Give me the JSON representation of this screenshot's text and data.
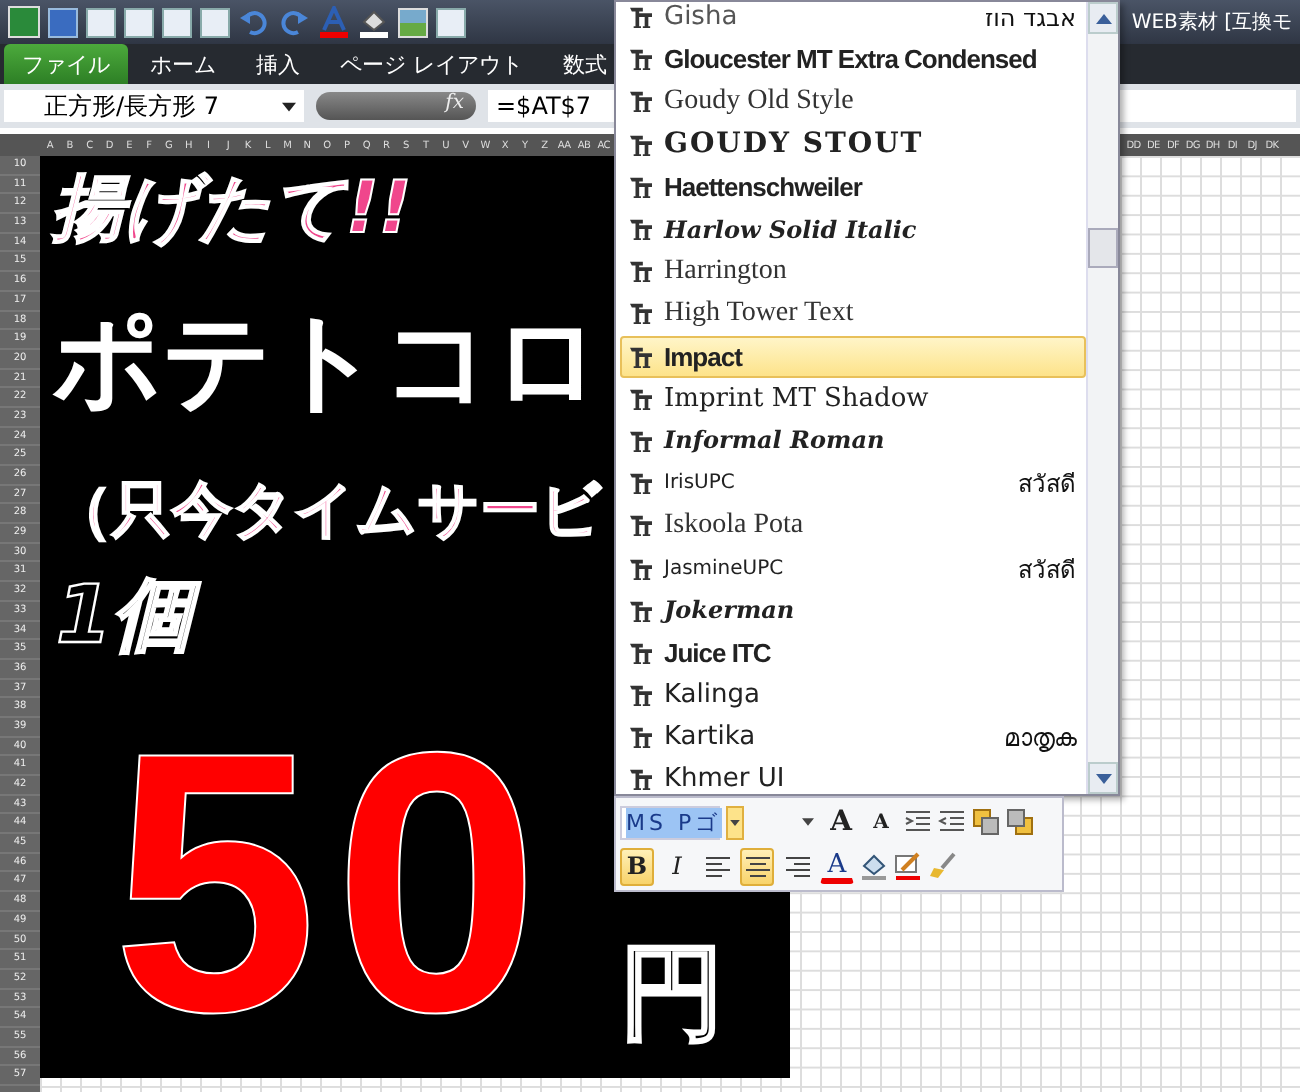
{
  "window": {
    "title": "WEB素材 [互換モ"
  },
  "tabs": [
    {
      "label": "ファイル",
      "selected": true
    },
    {
      "label": "ホーム",
      "selected": false
    },
    {
      "label": "挿入",
      "selected": false
    },
    {
      "label": "ページ レイアウト",
      "selected": false
    },
    {
      "label": "数式",
      "selected": false
    }
  ],
  "formula_bar": {
    "name_box": "正方形/長方形 7",
    "fx": "fx",
    "formula": "=$AT$7"
  },
  "columns_left": [
    "A",
    "B",
    "C",
    "D",
    "E",
    "F",
    "G",
    "H",
    "I",
    "J",
    "K",
    "L",
    "M",
    "N",
    "O",
    "P",
    "Q",
    "R",
    "S",
    "T",
    "U",
    "V",
    "W",
    "X",
    "Y",
    "Z",
    "AA",
    "AB",
    "AC"
  ],
  "columns_right": [
    "DD",
    "DE",
    "DF",
    "DG",
    "DH",
    "DI",
    "DJ",
    "DK"
  ],
  "rows": [
    "10",
    "11",
    "12",
    "13",
    "14",
    "15",
    "16",
    "17",
    "18",
    "19",
    "20",
    "21",
    "22",
    "23",
    "24",
    "25",
    "26",
    "27",
    "28",
    "29",
    "30",
    "31",
    "32",
    "33",
    "34",
    "35",
    "36",
    "37",
    "38",
    "39",
    "40",
    "41",
    "42",
    "43",
    "44",
    "45",
    "46",
    "47",
    "48",
    "49",
    "50",
    "51",
    "52",
    "53",
    "54",
    "55",
    "56",
    "57"
  ],
  "sheet": {
    "headline": "揚げたて!!",
    "product": "ポテトコロ",
    "note": "（只今タイムサービ",
    "unit": "1個",
    "price": "50",
    "currency": "円"
  },
  "font_menu": {
    "items": [
      {
        "name": "Gisha",
        "sample": "אבגד הוז",
        "kind": "light",
        "selected": false
      },
      {
        "name": "Gloucester MT Extra Condensed",
        "kind": "condensed",
        "selected": false
      },
      {
        "name": "Goudy Old Style",
        "kind": "serif",
        "selected": false
      },
      {
        "name": "GOUDY STOUT",
        "kind": "heavy",
        "selected": false
      },
      {
        "name": "Haettenschweiler",
        "kind": "condensed",
        "selected": false
      },
      {
        "name": "Harlow Solid Italic",
        "kind": "script",
        "selected": false
      },
      {
        "name": "Harrington",
        "kind": "serif",
        "selected": false
      },
      {
        "name": "High Tower Text",
        "kind": "serif",
        "selected": false
      },
      {
        "name": "Impact",
        "kind": "condensed",
        "selected": true
      },
      {
        "name": "Imprint MT Shadow",
        "kind": "boldserif",
        "selected": false
      },
      {
        "name": "Informal Roman",
        "kind": "script",
        "selected": false
      },
      {
        "name": "IrisUPC",
        "sample": "สวัสดี",
        "kind": "small",
        "selected": false
      },
      {
        "name": "Iskoola Pota",
        "kind": "serif",
        "selected": false
      },
      {
        "name": "JasmineUPC",
        "sample": "สวัสดี",
        "kind": "small",
        "selected": false
      },
      {
        "name": "Jokerman",
        "kind": "script",
        "selected": false
      },
      {
        "name": "Juice ITC",
        "kind": "condensed",
        "selected": false
      },
      {
        "name": "Kalinga",
        "kind": "sans",
        "selected": false
      },
      {
        "name": "Kartika",
        "sample": "മാതൃക",
        "kind": "sans",
        "selected": false
      },
      {
        "name": "Khmer UI",
        "kind": "sans",
        "selected": false
      }
    ]
  },
  "mini_toolbar": {
    "font": "MS Pゴ",
    "grow_label": "A",
    "shrink_label": "A",
    "bold_label": "B",
    "italic_label": "I",
    "color_label": "A",
    "bold": true,
    "italic": false,
    "align": [
      {
        "kind": "left",
        "selected": false
      },
      {
        "kind": "center",
        "selected": true
      },
      {
        "kind": "right",
        "selected": false
      }
    ]
  }
}
